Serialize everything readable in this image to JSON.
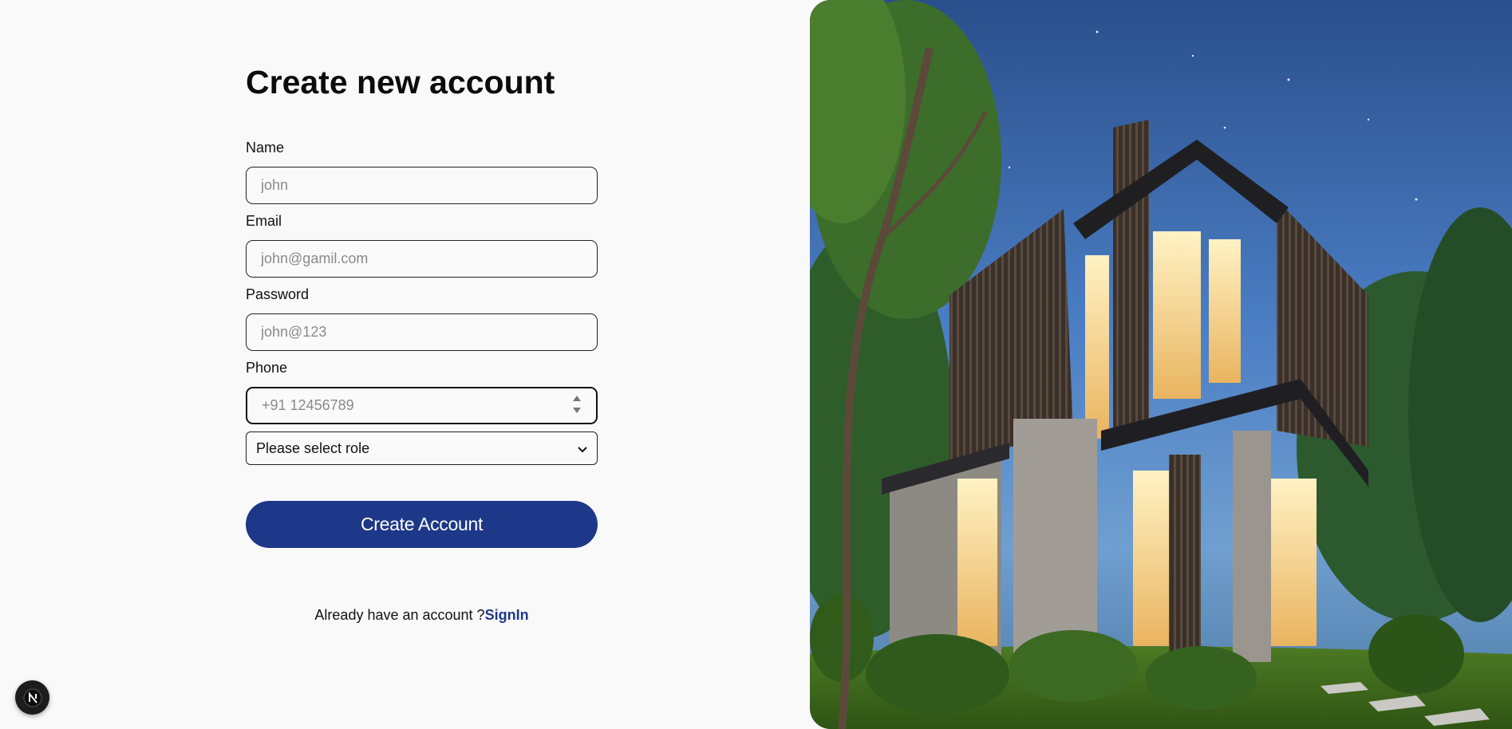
{
  "heading": "Create new account",
  "form": {
    "name": {
      "label": "Name",
      "placeholder": "john"
    },
    "email": {
      "label": "Email",
      "placeholder": "john@gamil.com"
    },
    "password": {
      "label": "Password",
      "placeholder": "john@123"
    },
    "phone": {
      "label": "Phone",
      "placeholder": "+91 12456789"
    },
    "role": {
      "selected": "Please select role"
    },
    "submit_label": "Create Account"
  },
  "signin": {
    "prompt": "Already have an account ?",
    "link_label": "SignIn"
  },
  "badge": {
    "letter": "N",
    "icon": "nextjs-dev-badge-icon"
  },
  "colors": {
    "primary": "#1d3888",
    "background": "#f9f9f9",
    "sky": "#3d6fb8",
    "lawn": "#3f6a1e"
  },
  "hero_image": {
    "subject": "modern-house-at-dusk-illustration"
  }
}
